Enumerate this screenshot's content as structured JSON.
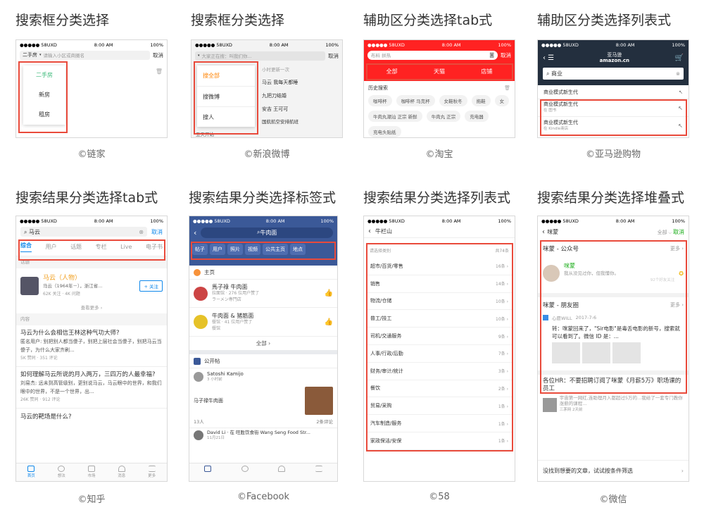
{
  "titles": [
    "搜索框分类选择",
    "搜索框分类选择",
    "辅助区分类选择tab式",
    "辅助区分类选择列表式",
    "搜索结果分类选择tab式",
    "搜索结果分类选择标签式",
    "搜索结果分类选择列表式",
    "搜索结果分类选择堆叠式"
  ],
  "credits": [
    "©链家",
    "©新浪微博",
    "©淘宝",
    "©亚马逊购物",
    "©知乎",
    "©Facebook",
    "©58",
    "©微信"
  ],
  "status": {
    "carrier": "●●●●● 58UXD",
    "wifi": "⌔",
    "time": "8:00 AM",
    "battery": "100%"
  },
  "lianjia": {
    "selected": "二手房",
    "placeholder": "请输入小区或商圈名",
    "cancel": "取消",
    "options": [
      "二手房",
      "新房",
      "租房"
    ],
    "accent": "#3cba7a"
  },
  "weibo": {
    "placeholder": "大家正在搜：叫我们你...",
    "cancel": "取消",
    "options": [
      "搜全部",
      "搜微博",
      "搜人"
    ],
    "side": [
      "小时更新一次",
      "马云 我每天都睡",
      "九把刀结婚",
      "安吉 王可可",
      "国航航空安排航班",
      "五天开始"
    ],
    "accent": "#ff8200"
  },
  "taobao": {
    "placeholder": "布料 拼热",
    "cancel": "取消",
    "tabs": [
      "全部",
      "天猫",
      "店铺"
    ],
    "history_title": "历史搜索",
    "chips": [
      "咖啡杯",
      "咖啡杯 马克杯",
      "女鞋秋冬",
      "拖鞋",
      "女",
      "牛肉丸潮汕 正宗 新鲜",
      "牛肉丸 正宗",
      "充电器",
      "充电头贴纸"
    ],
    "accent": "#f22"
  },
  "amazon": {
    "logo": "亚马逊",
    "logo2": "amazon.cn",
    "query": "商业",
    "suggest": "商业模式新生代",
    "items": [
      {
        "title": "商业模式新生代",
        "sub": "在 图书"
      },
      {
        "title": "商业模式新生代",
        "sub": "在 Kindle商店"
      }
    ]
  },
  "zhihu": {
    "query": "马云",
    "cancel": "取消",
    "tabs": [
      "综合",
      "用户",
      "话题",
      "专栏",
      "Live",
      "电子书"
    ],
    "section_topic": "话题",
    "person": {
      "name": "马云（人物）",
      "desc": "马云（1964年－），浙江省...",
      "stats": "62K 关注 · 4K 问题",
      "follow": "+ 关注"
    },
    "more": "查看更多",
    "section_content": "内容",
    "posts": [
      {
        "title": "马云为什么会相信王林这种气功大师?",
        "body": "匿名用户: 别把别人都当傻子，别把上层社会当傻子，别把马云当傻子，为什么大家齐刷...",
        "meta": "5K 赞同 · 351 评论"
      },
      {
        "title": "如何理解马云所说的月入两万，三四万的人最幸福?",
        "body": "刘易杰: 远未到高管级别，更别说马云，马云眼中的世界，和我们眼中的世界，不是一个世界，出...",
        "meta": "26K 赞同 · 912 评论"
      },
      {
        "title": "马云的靶场是什么?",
        "body": "",
        "meta": ""
      }
    ],
    "nav": [
      "首页",
      "想法",
      "市场",
      "消息",
      "更多"
    ]
  },
  "facebook": {
    "query": "牛肉面",
    "tags": [
      "帖子",
      "用户",
      "照片",
      "视频",
      "公共主页",
      "地点"
    ],
    "section_main": "主页",
    "pages": [
      {
        "title": "馬子祿 牛肉面",
        "sub": "拉面馆 · 276 位用户赞了",
        "sub2": "ラーメン専門店"
      },
      {
        "title": "牛肉面 & 猪筋面",
        "sub": "餐馆 · 41 位用户赞了",
        "sub2": "餐馆"
      }
    ],
    "all": "全部",
    "section_public": "公开帖",
    "post": {
      "author": "Satoshi Kamijo",
      "time": "3 小时前",
      "text": "马子禄牛肉面",
      "likes": "13人",
      "comments": "2条评论"
    },
    "post2": {
      "author": "David Li",
      "action": "在 旺胜饮食街 Wang Seng Food Str...",
      "time": "11月21日"
    }
  },
  "wuba": {
    "query": "牛栏山",
    "header_left": "请选择类别",
    "header_right": "共74条",
    "rows": [
      {
        "label": "超市/百货/零售",
        "count": "16条"
      },
      {
        "label": "销售",
        "count": "14条"
      },
      {
        "label": "物流/仓储",
        "count": "10条"
      },
      {
        "label": "普工/技工",
        "count": "10条"
      },
      {
        "label": "司机/交通服务",
        "count": "9条"
      },
      {
        "label": "人事/行政/后勤",
        "count": "7条"
      },
      {
        "label": "财务/审计/统计",
        "count": "3条"
      },
      {
        "label": "餐饮",
        "count": "2条"
      },
      {
        "label": "贸易/采购",
        "count": "1条"
      },
      {
        "label": "汽车制造/服务",
        "count": "1条"
      },
      {
        "label": "家政保洁/安保",
        "count": "1条"
      }
    ]
  },
  "wechat": {
    "query": "咪蒙",
    "filter": "全部",
    "cancel": "取消",
    "g1_title": "咪蒙 - 公众号",
    "more": "更多",
    "account": {
      "name": "咪蒙",
      "desc": "我从没见过你，但我懂你。",
      "note": "92个好友关注"
    },
    "g2_title": "咪蒙 - 朋友圈",
    "moment": {
      "author": "心愿WILL",
      "date": "2017-7-6",
      "text": "转：咪蒙回来了，\"Sir电影\"是毒舌电影的新号，搜索就可以看到了。微信 ID 是：..."
    },
    "article": {
      "title": "各位HR：不要招聘订阅了咪蒙《月薪5万》职场课的员工",
      "body": "宇宙第一网红,连助理月入都超过5万的...我给了一套专门教你涨薪的课程...",
      "source": "三茅网 2天前"
    },
    "bottom": "没找到想要的文章，试试按条件筛选",
    "accent": "#1aad19"
  }
}
